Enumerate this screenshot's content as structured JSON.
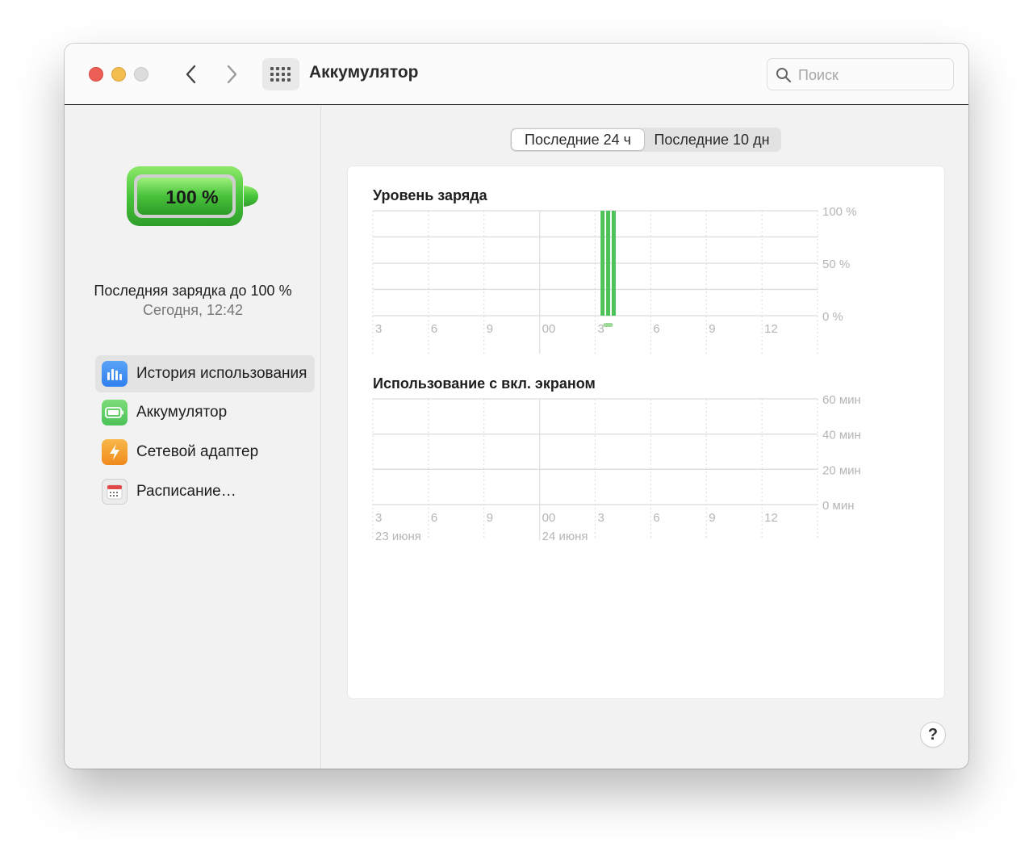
{
  "window": {
    "title": "Аккумулятор",
    "search_placeholder": "Поиск"
  },
  "sidebar": {
    "battery_percent": "100 %",
    "last_charge_label": "Последняя зарядка до 100 %",
    "last_charge_time": "Сегодня, 12:42",
    "items": [
      {
        "label": "История использования",
        "icon": "bar-chart-icon",
        "active": true,
        "color": "#3b82f6"
      },
      {
        "label": "Аккумулятор",
        "icon": "battery-icon",
        "active": false,
        "color": "#4cc259"
      },
      {
        "label": "Сетевой адаптер",
        "icon": "lightning-icon",
        "active": false,
        "color": "#f59a23"
      },
      {
        "label": "Расписание…",
        "icon": "calendar-icon",
        "active": false,
        "color": "#e04848"
      }
    ]
  },
  "segments": {
    "last_24h": "Последние 24 ч",
    "last_10d": "Последние 10 дн",
    "selected": "last_24h"
  },
  "help_label": "?",
  "chart_data": [
    {
      "type": "bar",
      "title": "Уровень заряда",
      "x_ticks": [
        "3",
        "6",
        "9",
        "00",
        "3",
        "6",
        "9",
        "12"
      ],
      "y_ticks": [
        "100 %",
        "50 %",
        "0 %"
      ],
      "ylim": [
        0,
        100
      ],
      "bars": [
        {
          "slot": 12.4,
          "value": 100
        },
        {
          "slot": 12.7,
          "value": 100
        },
        {
          "slot": 13.0,
          "value": 100
        }
      ],
      "charging_indicator_slot": 12.7,
      "color": "#4cc259"
    },
    {
      "type": "bar",
      "title": "Использование с вкл. экраном",
      "x_ticks": [
        "3",
        "6",
        "9",
        "00",
        "3",
        "6",
        "9",
        "12"
      ],
      "y_ticks": [
        "60 мин",
        "40 мин",
        "20 мин",
        "0 мин"
      ],
      "ylim": [
        0,
        60
      ],
      "date_labels": [
        "23 июня",
        "24 июня"
      ],
      "bars": []
    }
  ]
}
